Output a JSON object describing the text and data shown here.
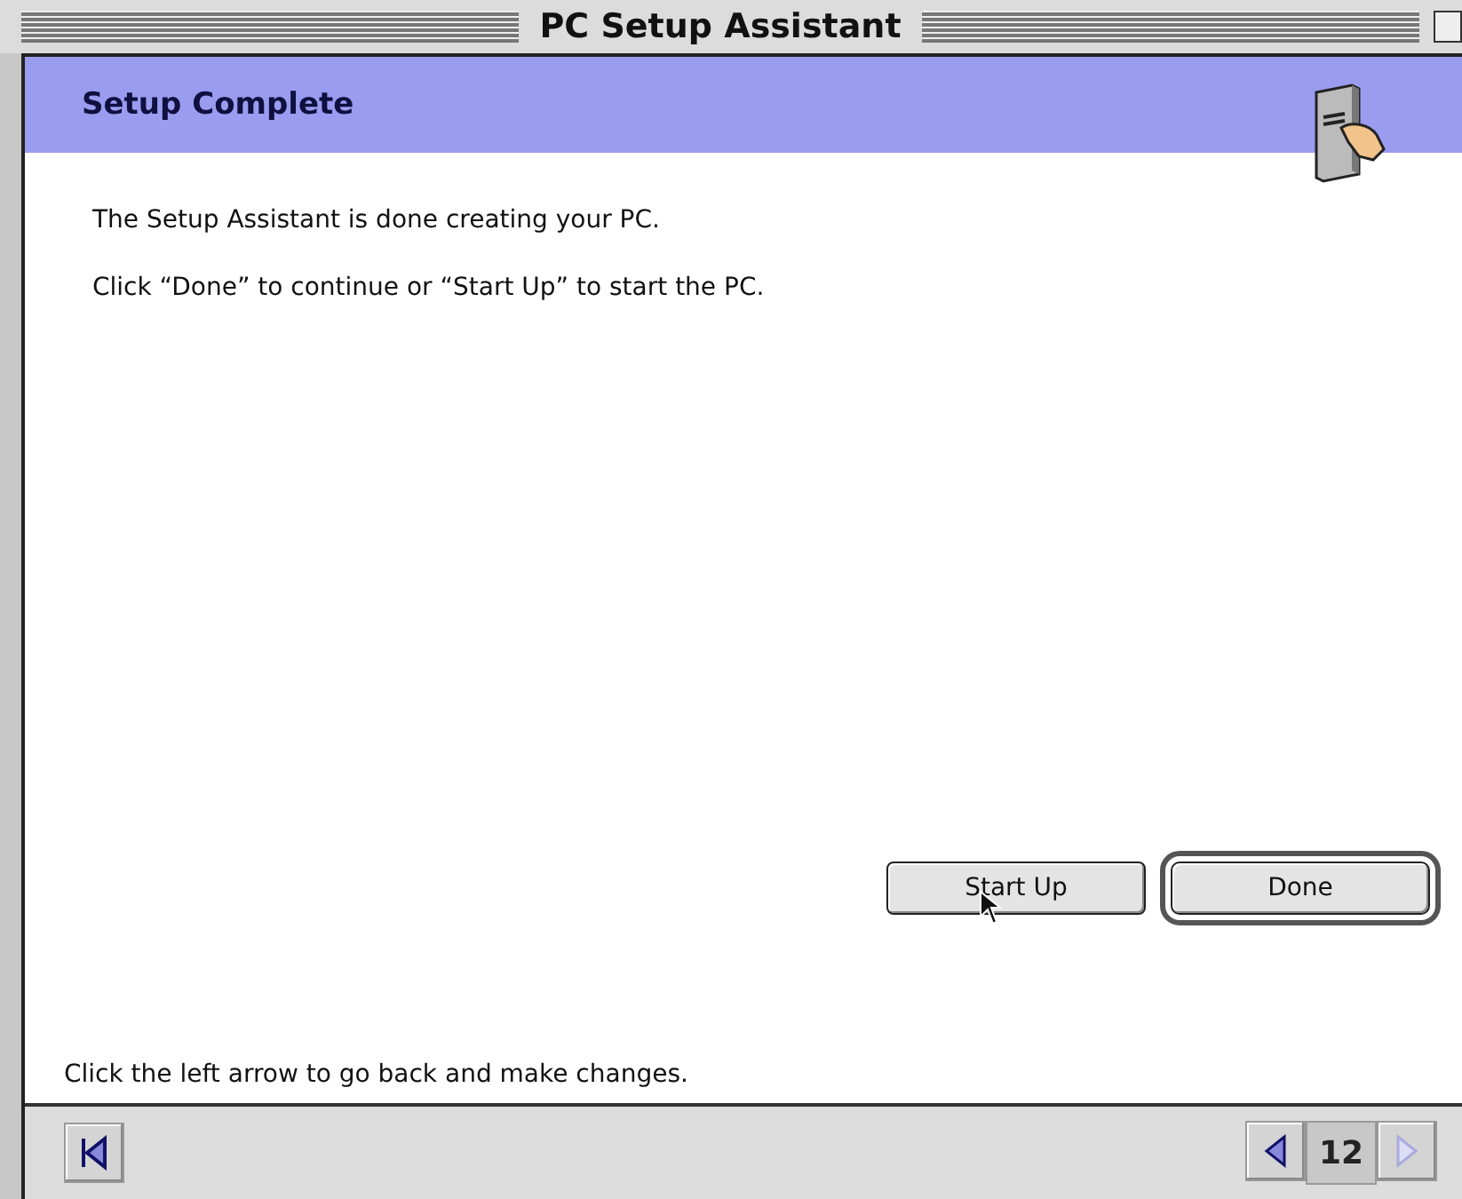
{
  "window": {
    "title": "PC Setup Assistant"
  },
  "header": {
    "title": "Setup Complete"
  },
  "body": {
    "lines": [
      "The Setup Assistant is done creating your PC.",
      "Click “Done” to continue or “Start Up” to start the PC."
    ]
  },
  "buttons": [
    {
      "label": "Start Up",
      "default": false
    },
    {
      "label": "Done",
      "default": true
    }
  ],
  "footer_hint": "Click the left arrow to go back and make changes.",
  "nav": {
    "page": "12",
    "back_disabled": false,
    "next_disabled": true
  }
}
